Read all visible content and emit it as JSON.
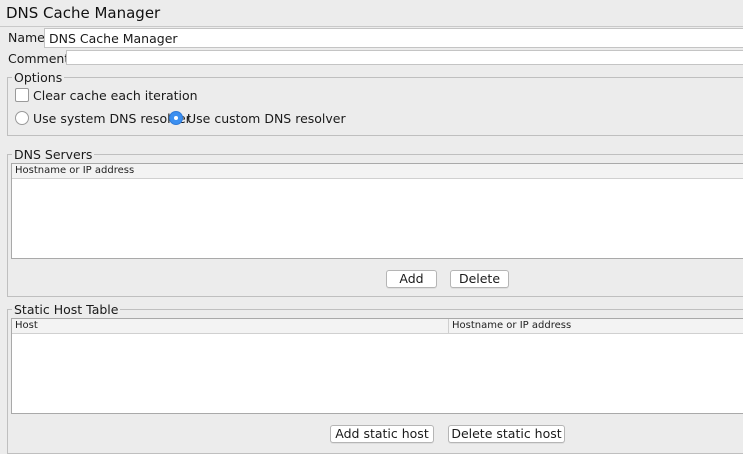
{
  "window": {
    "title": "DNS Cache Manager"
  },
  "form": {
    "name_label": "Name:",
    "name_value": "DNS Cache Manager",
    "comments_label": "Comments:",
    "comments_value": ""
  },
  "options": {
    "legend": "Options",
    "clear_cache_label": "Clear cache each iteration",
    "clear_cache_checked": false,
    "system_resolver_label": "Use system DNS resolver",
    "custom_resolver_label": "Use custom DNS resolver",
    "selected_resolver": "custom"
  },
  "dns_servers": {
    "legend": "DNS Servers",
    "columns": [
      "Hostname or IP address"
    ],
    "rows": [],
    "add_label": "Add",
    "delete_label": "Delete"
  },
  "static_hosts": {
    "legend": "Static Host Table",
    "columns": [
      "Host",
      "Hostname or IP address"
    ],
    "rows": [],
    "add_label": "Add static host",
    "delete_label": "Delete static host"
  },
  "colors": {
    "accent": "#3b8ff0",
    "background": "#ececec"
  }
}
